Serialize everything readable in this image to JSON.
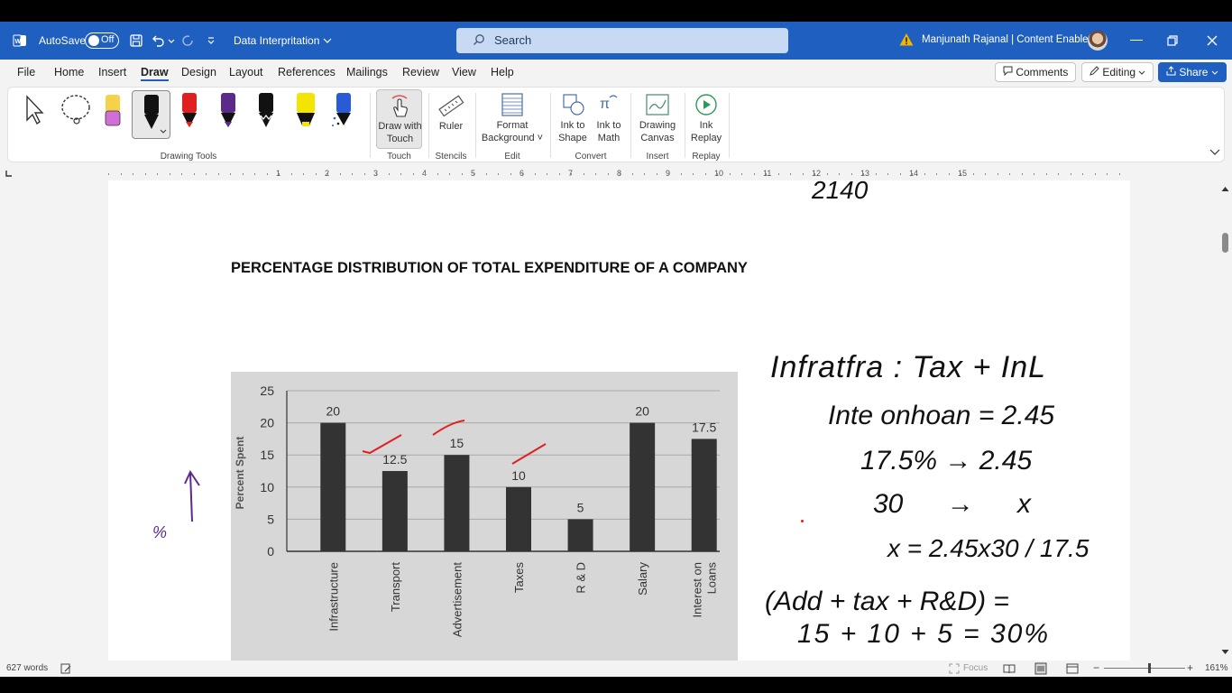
{
  "titlebar": {
    "autosave_label": "AutoSave",
    "autosave_state": "Off",
    "document_name": "Data Interpritation",
    "search_placeholder": "Search",
    "user_name": "Manjunath Rajanal | Content Enablers",
    "accent_color": "#1f5fbf"
  },
  "menu": {
    "tabs": [
      "File",
      "Home",
      "Insert",
      "Draw",
      "Design",
      "Layout",
      "References",
      "Mailings",
      "Review",
      "View",
      "Help"
    ],
    "active_tab": "Draw",
    "comments_label": "Comments",
    "editing_label": "Editing",
    "share_label": "Share"
  },
  "ribbon": {
    "groups": {
      "drawing_tools": "Drawing Tools",
      "touch": "Touch",
      "stencils": "Stencils",
      "edit": "Edit",
      "convert": "Convert",
      "insert": "Insert",
      "replay": "Replay"
    },
    "buttons": {
      "draw_with_touch_1": "Draw with",
      "draw_with_touch_2": "Touch",
      "ruler": "Ruler",
      "format_background_1": "Format",
      "format_background_2": "Background",
      "ink_to_shape_1": "Ink to",
      "ink_to_shape_2": "Shape",
      "ink_to_math_1": "Ink to",
      "ink_to_math_2": "Math",
      "drawing_canvas_1": "Drawing",
      "drawing_canvas_2": "Canvas",
      "ink_replay_1": "Ink",
      "ink_replay_2": "Replay"
    },
    "pen_colors": [
      "#111111",
      "#e02020",
      "#5b2a8a",
      "#111111",
      "#f2e600",
      "#2a5bd7"
    ]
  },
  "ruler": {
    "numbers": [
      "1",
      "2",
      "3",
      "4",
      "5",
      "6",
      "7",
      "8",
      "9",
      "10",
      "11",
      "12",
      "13",
      "14",
      "15"
    ]
  },
  "document": {
    "heading": "PERCENTAGE DISTRIBUTION OF TOTAL EXPENDITURE OF A COMPANY",
    "ink_top": "2140",
    "ink_notes": [
      "Infratfra : Tax + InL",
      "Inte onhoan = 2.45",
      "17.5% → 2.45",
      "30 → x",
      "x = 2.45x30 / 17.5",
      "(Add + tax + R&D) =",
      "15 + 10 + 5 = 30%"
    ],
    "ink_left": "%",
    "ink_color": "#000000",
    "ink_purple": "#5b2a8a",
    "ink_red": "#e02020"
  },
  "chart_data": {
    "type": "bar",
    "ylabel": "Percent Spent",
    "ylim": [
      0,
      25
    ],
    "yticks": [
      "0",
      "5",
      "10",
      "15",
      "20",
      "25"
    ],
    "categories": [
      "Infrastructure",
      "Transport",
      "Advertisement",
      "Taxes",
      "R & D",
      "Salary",
      "Interest on Loans"
    ],
    "values": [
      20,
      12.5,
      15,
      10,
      5,
      20,
      17.5
    ],
    "value_labels": [
      "20",
      "12.5",
      "15",
      "10",
      "5",
      "20",
      "17.5"
    ],
    "grid": true
  },
  "status": {
    "word_count": "627 words",
    "focus_label": "Focus",
    "zoom": "161%"
  }
}
